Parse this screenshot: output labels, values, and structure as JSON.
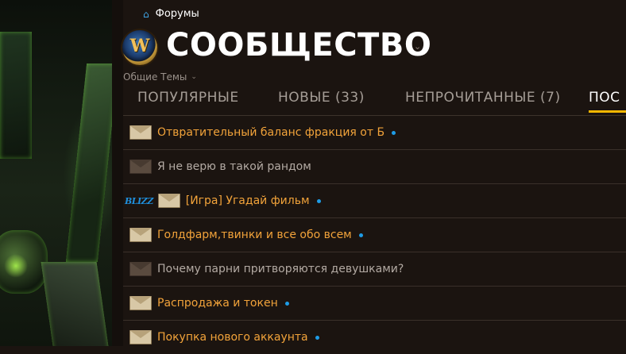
{
  "breadcrumb": {
    "label": "Форумы",
    "icon": "home-icon"
  },
  "header": {
    "title": "СООБЩЕСТВО",
    "logo_letter": "W"
  },
  "subcategory": {
    "label": "Общие Темы"
  },
  "tabs": [
    {
      "label": "ПОПУЛЯРНЫЕ"
    },
    {
      "label": "НОВЫЕ (33)"
    },
    {
      "label": "НЕПРОЧИТАННЫЕ (7)"
    },
    {
      "label": "ПОС"
    }
  ],
  "topics": [
    {
      "title": "Отвратительный баланс фракция от Б",
      "unread": true
    },
    {
      "title": "Я не верю в такой рандом",
      "unread": false
    },
    {
      "title": "[Игра] Угадай фильм",
      "unread": true,
      "blizzard": true,
      "blizz_tag": "BLIZZ"
    },
    {
      "title": "Голдфарм,твинки и все обо всем",
      "unread": true
    },
    {
      "title": "Почему парни притворяются девушками?",
      "unread": false
    },
    {
      "title": "Распродажа и токен",
      "unread": true
    },
    {
      "title": "Покупка нового аккаунта",
      "unread": true
    }
  ],
  "colors": {
    "accent": "#f8b700",
    "unread_title": "#f2a33a",
    "new_dot": "#1e9ce6"
  }
}
